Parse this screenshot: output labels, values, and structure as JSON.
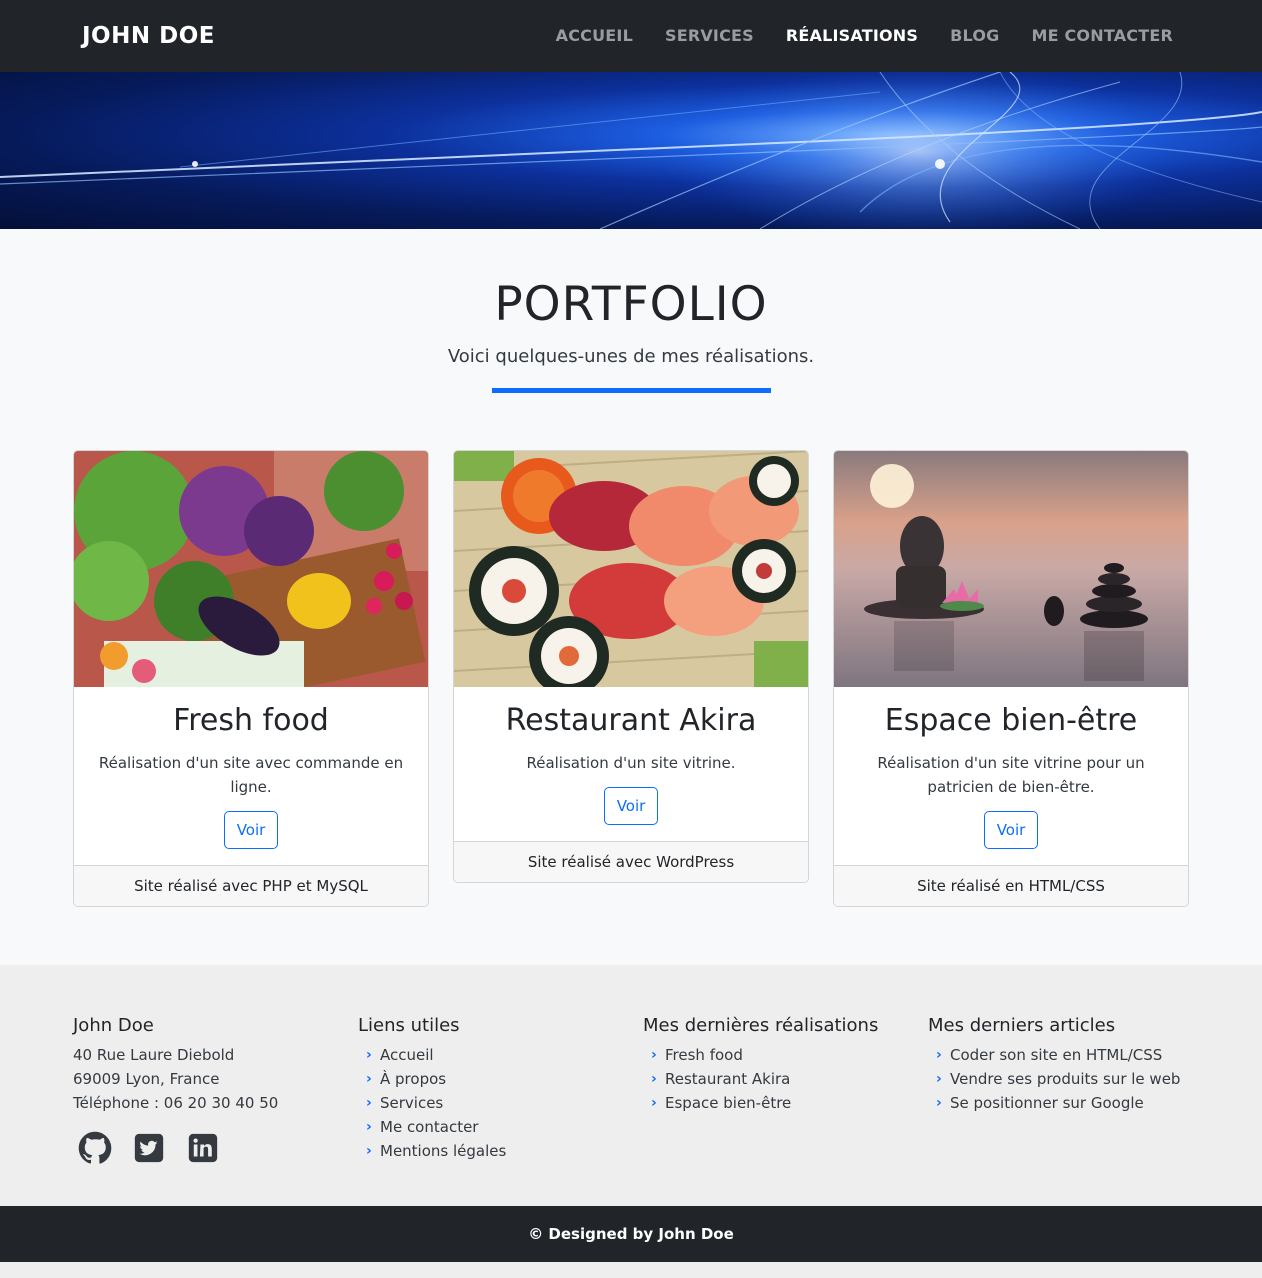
{
  "navbar": {
    "brand": "JOHN DOE",
    "links": [
      "ACCUEIL",
      "SERVICES",
      "RÉALISATIONS",
      "BLOG",
      "ME CONTACTER"
    ],
    "active_index": 2
  },
  "portfolio": {
    "title": "PORTFOLIO",
    "subtitle": "Voici quelques-unes de mes réalisations.",
    "cards": [
      {
        "image": "vegetables-basket-photo",
        "title": "Fresh food",
        "text": "Réalisation d'un site avec commande en ligne.",
        "button": "Voir",
        "footer": "Site réalisé avec PHP et MySQL"
      },
      {
        "image": "sushi-platter-photo",
        "title": "Restaurant Akira",
        "text": "Réalisation d'un site vitrine.",
        "button": "Voir",
        "footer": "Site réalisé avec WordPress"
      },
      {
        "image": "buddha-zen-stones-photo",
        "title": "Espace bien-être",
        "text": "Réalisation d'un site vitrine pour un patricien de bien-être.",
        "button": "Voir",
        "footer": "Site réalisé en HTML/CSS"
      }
    ]
  },
  "footer": {
    "contact": {
      "heading": "John Doe",
      "address1": "40 Rue Laure Diebold",
      "address2": "69009 Lyon, France",
      "phone": "Téléphone : 06 20 30 40 50",
      "socials": [
        "github-icon",
        "twitter-icon",
        "linkedin-icon"
      ]
    },
    "links": {
      "heading": "Liens utiles",
      "items": [
        "Accueil",
        "À propos",
        "Services",
        "Me contacter",
        "Mentions légales"
      ]
    },
    "works": {
      "heading": "Mes dernières réalisations",
      "items": [
        "Fresh food",
        "Restaurant Akira",
        "Espace bien-être"
      ]
    },
    "articles": {
      "heading": "Mes derniers articles",
      "items": [
        "Coder son site en HTML/CSS",
        "Vendre ses produits sur le web",
        "Se positionner sur Google"
      ]
    },
    "copyright": "© Designed by John Doe"
  },
  "colors": {
    "accent": "#0d6efd",
    "dark": "#212529",
    "nav_inactive": "#9a9da0"
  }
}
